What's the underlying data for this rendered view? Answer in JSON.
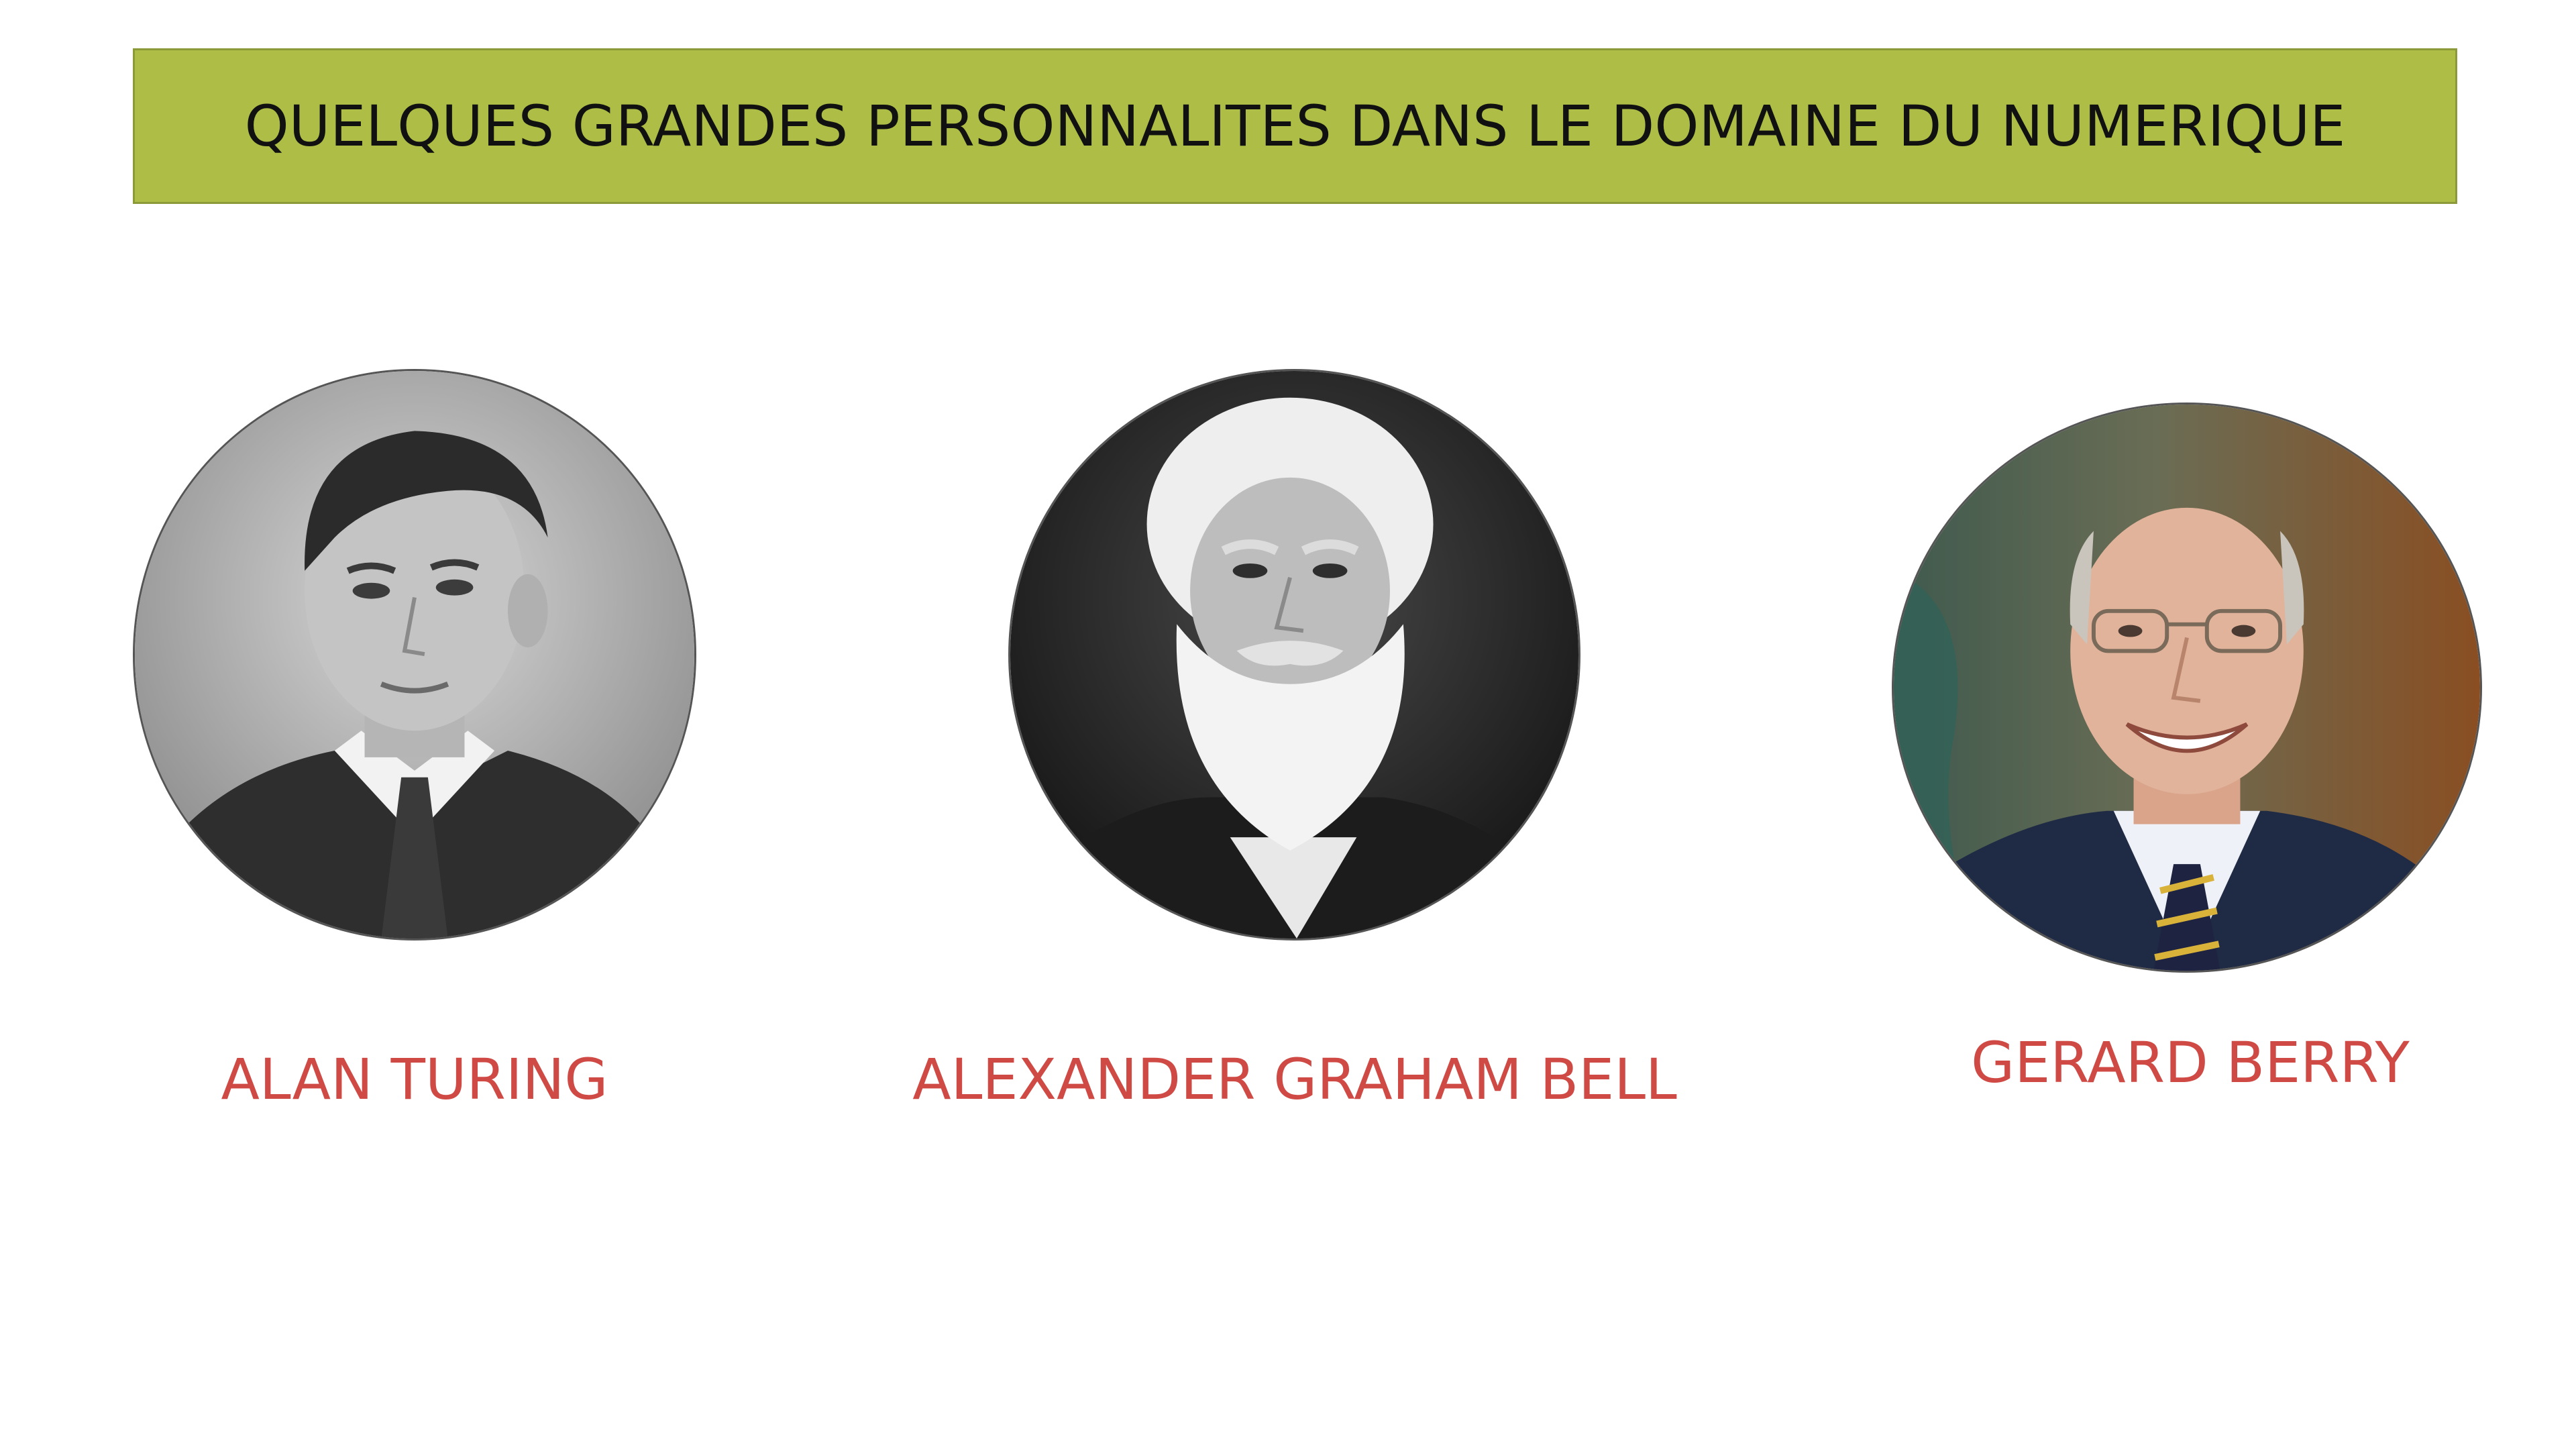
{
  "slide": {
    "title": "QUELQUES GRANDES PERSONNALITES DANS LE DOMAINE DU NUMERIQUE",
    "title_bg_color": "#adbd45",
    "name_color": "#d04a45"
  },
  "personalities": [
    {
      "name": "ALAN TURING",
      "photo_style": "black-and-white"
    },
    {
      "name": "ALEXANDER GRAHAM BELL",
      "photo_style": "black-and-white"
    },
    {
      "name": "GERARD BERRY",
      "photo_style": "color"
    }
  ]
}
